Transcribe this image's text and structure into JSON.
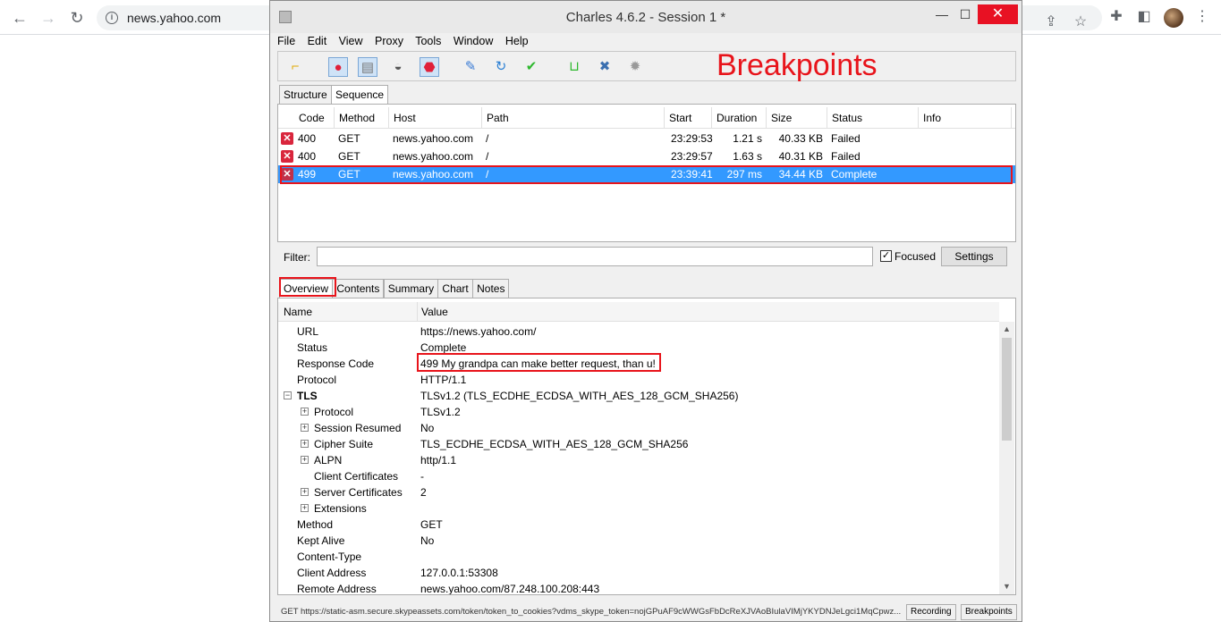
{
  "browser": {
    "url": "news.yahoo.com"
  },
  "window": {
    "title": "Charles 4.6.2 - Session 1 *",
    "close_glyph": "✕",
    "min_glyph": "—",
    "max_glyph": "☐"
  },
  "menu": [
    "File",
    "Edit",
    "View",
    "Proxy",
    "Tools",
    "Window",
    "Help"
  ],
  "toolbar": {
    "annotation": "Breakpoints"
  },
  "session_tabs": [
    "Structure",
    "Sequence"
  ],
  "table": {
    "headers": [
      "Code",
      "Method",
      "Host",
      "Path",
      "Start",
      "Duration",
      "Size",
      "Status",
      "Info"
    ],
    "rows": [
      {
        "code": "400",
        "method": "GET",
        "host": "news.yahoo.com",
        "path": "/",
        "start": "23:29:53",
        "duration": "1.21 s",
        "size": "40.33 KB",
        "status": "Failed",
        "info": ""
      },
      {
        "code": "400",
        "method": "GET",
        "host": "news.yahoo.com",
        "path": "/",
        "start": "23:29:57",
        "duration": "1.63 s",
        "size": "40.31 KB",
        "status": "Failed",
        "info": ""
      },
      {
        "code": "499",
        "method": "GET",
        "host": "news.yahoo.com",
        "path": "/",
        "start": "23:39:41",
        "duration": "297 ms",
        "size": "34.44 KB",
        "status": "Complete",
        "info": ""
      }
    ]
  },
  "filter": {
    "label": "Filter:",
    "value": "",
    "focused_label": "Focused",
    "focused_checked": true,
    "settings_label": "Settings"
  },
  "detail_tabs": [
    "Overview",
    "Contents",
    "Summary",
    "Chart",
    "Notes"
  ],
  "detail": {
    "name_header": "Name",
    "value_header": "Value",
    "rows": [
      {
        "name": "URL",
        "value": "https://news.yahoo.com/"
      },
      {
        "name": "Status",
        "value": "Complete"
      },
      {
        "name": "Response Code",
        "value": "499 My grandpa can make better request, than u!"
      },
      {
        "name": "Protocol",
        "value": "HTTP/1.1"
      },
      {
        "name": "TLS",
        "value": "TLSv1.2 (TLS_ECDHE_ECDSA_WITH_AES_128_GCM_SHA256)"
      },
      {
        "name": "Protocol",
        "value": "TLSv1.2"
      },
      {
        "name": "Session Resumed",
        "value": "No"
      },
      {
        "name": "Cipher Suite",
        "value": "TLS_ECDHE_ECDSA_WITH_AES_128_GCM_SHA256"
      },
      {
        "name": "ALPN",
        "value": "http/1.1"
      },
      {
        "name": "Client Certificates",
        "value": "-"
      },
      {
        "name": "Server Certificates",
        "value": "2"
      },
      {
        "name": "Extensions",
        "value": ""
      },
      {
        "name": "Method",
        "value": "GET"
      },
      {
        "name": "Kept Alive",
        "value": "No"
      },
      {
        "name": "Content-Type",
        "value": ""
      },
      {
        "name": "Client Address",
        "value": "127.0.0.1:53308"
      },
      {
        "name": "Remote Address",
        "value": "news.yahoo.com/87.248.100.208:443"
      }
    ]
  },
  "statusbar": {
    "text": "GET https://static-asm.secure.skypeassets.com/token/token_to_cookies?vdms_skype_token=nojGPuAF9cWWGsFbDcReXJVAoBIulaVIMjYKYDNJeLgci1MqCpwz...",
    "recording_label": "Recording",
    "breakpoints_label": "Breakpoints"
  },
  "colors": {
    "annotation_red": "#e8141b",
    "selection_blue": "#3399ff",
    "error_red": "#d9263d"
  }
}
